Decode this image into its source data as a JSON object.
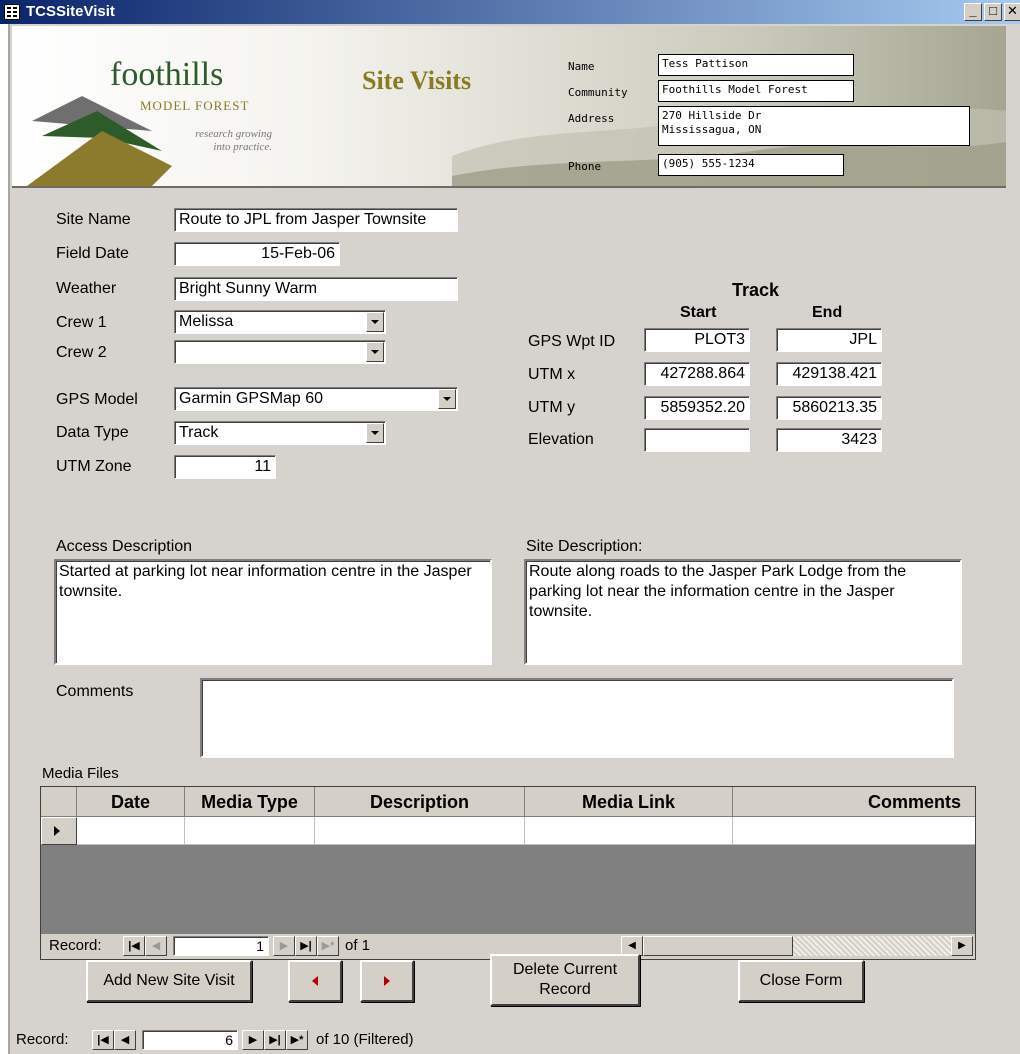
{
  "window": {
    "title": "TCSSiteVisit"
  },
  "header": {
    "logo": {
      "word": "foothills",
      "sub": "MODEL FOREST",
      "tagline1": "research growing",
      "tagline2": "into practice."
    },
    "title": "Site Visits",
    "name_label": "Name",
    "name": "Tess Pattison",
    "community_label": "Community",
    "community": "Foothills Model Forest",
    "address_label": "Address",
    "address_line1": "270 Hillside Dr",
    "address_line2": "Mississagua, ON",
    "phone_label": "Phone",
    "phone": "(905) 555-1234"
  },
  "form": {
    "site_name_label": "Site Name",
    "site_name": "Route to JPL from Jasper Townsite",
    "field_date_label": "Field Date",
    "field_date": "15-Feb-06",
    "weather_label": "Weather",
    "weather": "Bright Sunny Warm",
    "crew1_label": "Crew 1",
    "crew1": "Melissa",
    "crew2_label": "Crew 2",
    "crew2": "",
    "gps_model_label": "GPS Model",
    "gps_model": "Garmin GPSMap 60",
    "data_type_label": "Data Type",
    "data_type": "Track",
    "utm_zone_label": "UTM Zone",
    "utm_zone": "11"
  },
  "track": {
    "title": "Track",
    "start_label": "Start",
    "end_label": "End",
    "gps_wpt_label": "GPS Wpt ID",
    "gps_wpt_start": "PLOT3",
    "gps_wpt_end": "JPL",
    "utmx_label": "UTM x",
    "utmx_start": "427288.864",
    "utmx_end": "429138.421",
    "utmy_label": "UTM y",
    "utmy_start": "5859352.20",
    "utmy_end": "5860213.35",
    "elev_label": "Elevation",
    "elev_start": "",
    "elev_end": "3423"
  },
  "descriptions": {
    "access_label": "Access Description",
    "access": "Started at parking lot near information centre in the Jasper townsite.",
    "site_label": "Site Description:",
    "site": "Route along roads to the Jasper Park Lodge from the parking lot near the information centre in the Jasper townsite.",
    "comments_label": "Comments",
    "comments": ""
  },
  "media": {
    "label": "Media Files",
    "columns": [
      "Date",
      "Media Type",
      "Description",
      "Media Link",
      "Comments"
    ],
    "nav": {
      "record_label": "Record:",
      "current": "1",
      "of_text": "of 1"
    }
  },
  "buttons": {
    "add_new": "Add New Site Visit",
    "delete_line1": "Delete Current",
    "delete_line2": "Record",
    "close": "Close Form"
  },
  "main_nav": {
    "record_label": "Record:",
    "current": "6",
    "of_text": "of 10 (Filtered)"
  },
  "colors": {
    "title_dark": "#0a246a",
    "form_bg": "#d6d3ce",
    "title_gold": "#8a7a22",
    "logo_green": "#2e5b2a",
    "arrow_red": "#b00000"
  }
}
